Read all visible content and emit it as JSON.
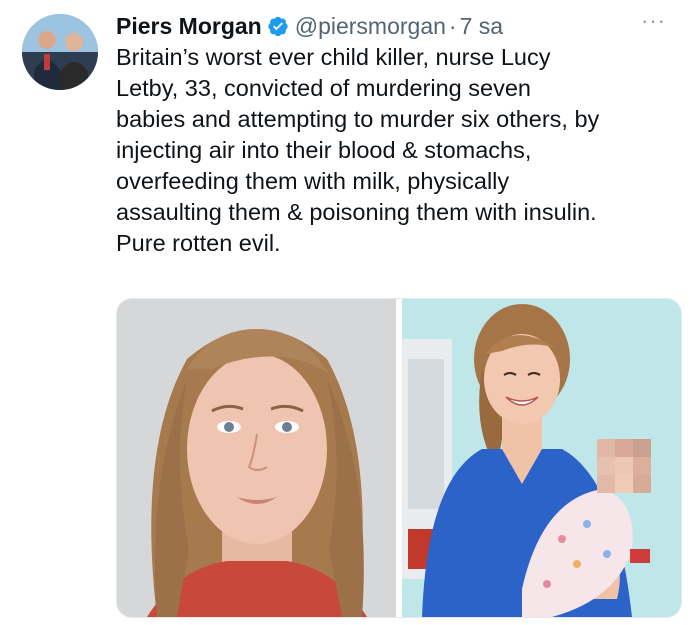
{
  "author": {
    "display_name": "Piers Morgan",
    "handle": "@piersmorgan",
    "separator": "·",
    "time": "7 sa",
    "avatar_icon": "avatar-photo",
    "verified_icon": "verified-badge-icon",
    "verified_color": "#1d9bf0"
  },
  "menu": {
    "more_icon": "···"
  },
  "tweet": {
    "lines": [
      "Britain’s worst ever child killer, nurse Lucy",
      "Letby, 33, convicted of murdering seven",
      "babies and attempting to murder six others, by",
      "injecting air into their blood & stomachs,",
      "overfeeding them with milk, physically",
      "assaulting them & poisoning them with insulin.",
      "Pure rotten evil."
    ]
  },
  "media": {
    "images": [
      {
        "name": "mugshot-photo"
      },
      {
        "name": "nurse-holding-baby-photo"
      }
    ]
  }
}
